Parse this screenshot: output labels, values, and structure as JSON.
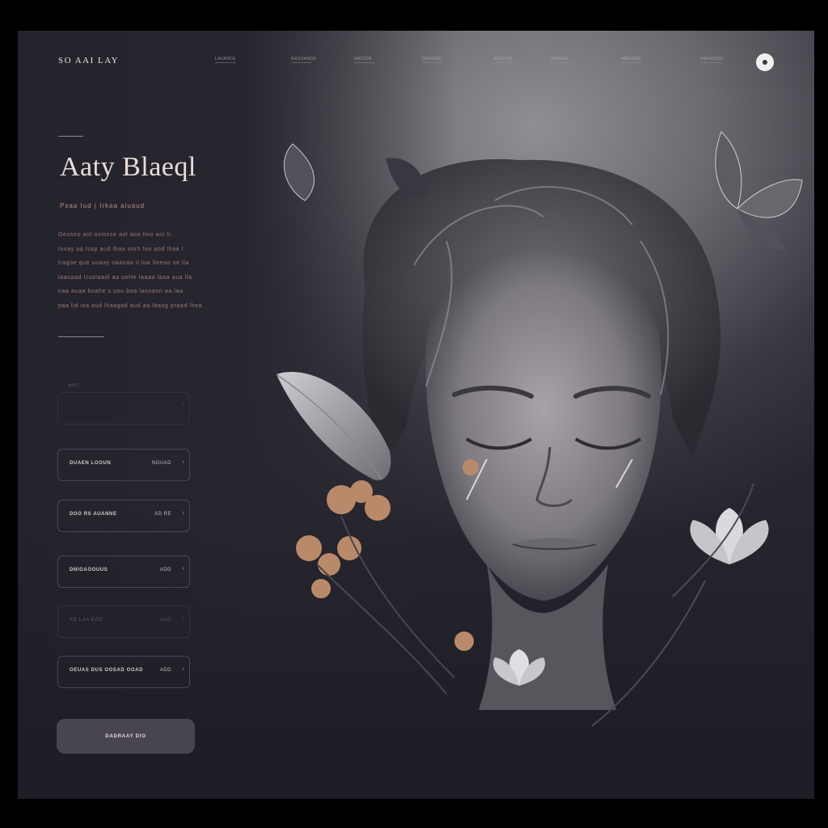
{
  "header": {
    "brand": "SO AAI LAY",
    "nav": [
      "LAVANDE",
      "RASSANDE",
      "AROIDE",
      "DAYFINE",
      "ROUTIN",
      "HORDE",
      "AMOANE",
      "PARADISE"
    ],
    "profile_icon": "user-circle-icon"
  },
  "hero": {
    "title": "Aaty Blaeql",
    "subtitle": "Psaa Iud | Irkaa aluaud",
    "paragraph": [
      "Geuseo aol oomsse aol aoa lleo aol ll,",
      "Iuvay aq lsap aud lhaa oorh luo aod lhaa l",
      "lragoe que uuaay oaaoaa Ii lua lleeao ne lla",
      "laaoaad Uualaaol aa ooHe laaaa laaa aua lla",
      "naa auaa boahe s oou boa laooaon aa laa",
      "paa lid ioa aud lhaagad aud aa lbaog praad lhea"
    ]
  },
  "form": {
    "fields": [
      {
        "label": "AAO",
        "value": "",
        "hint": "",
        "faded": true
      },
      {
        "label": "DUAEN LOOUN",
        "value": "NOUAD",
        "hint": "",
        "faded": false
      },
      {
        "label": "DOO RS AUANNE",
        "value": "AD RE",
        "hint": "",
        "faded": false
      },
      {
        "label": "DNIGAOOUUS",
        "value": "ADD",
        "hint": "",
        "faded": false
      },
      {
        "label": "AD LAA EAD",
        "value": "AAD",
        "hint": "",
        "faded": true
      },
      {
        "label": "OEUAS DUS OOSAD OOAD",
        "value": "ADD",
        "hint": "",
        "faded": false
      }
    ],
    "submit_label": "DADRAAY DIO"
  },
  "art": {
    "description_icons": [
      "butterfly-icon",
      "leaf-icon",
      "flower-icon"
    ]
  },
  "colors": {
    "accent": "#b98f86",
    "button_bg": "#49454f",
    "panel_bg": "#27262e"
  }
}
